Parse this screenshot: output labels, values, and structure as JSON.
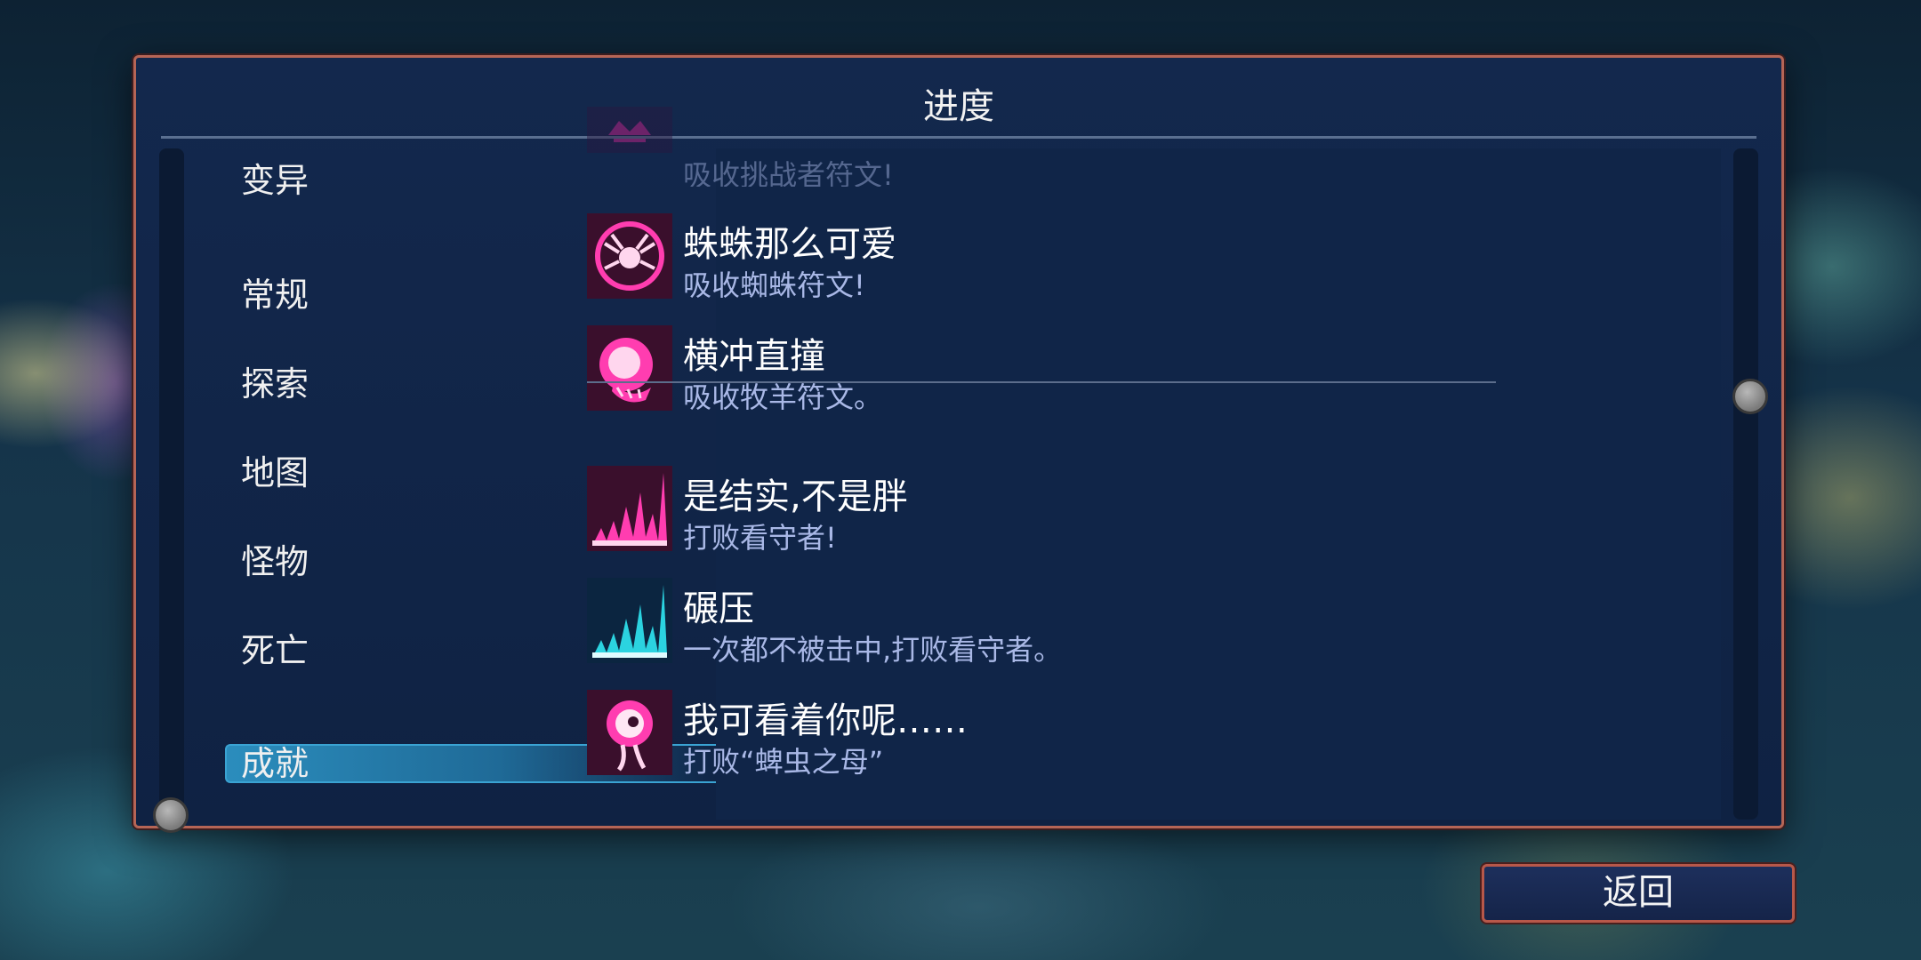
{
  "panel": {
    "title": "进度"
  },
  "categories": [
    {
      "label": "变异",
      "selected": false
    },
    {
      "label": "常规",
      "selected": false
    },
    {
      "label": "探索",
      "selected": false
    },
    {
      "label": "地图",
      "selected": false
    },
    {
      "label": "怪物",
      "selected": false
    },
    {
      "label": "死亡",
      "selected": false
    },
    {
      "label": "成就",
      "selected": true
    }
  ],
  "achievements": [
    {
      "name": "",
      "desc": "吸收挑战者符文!",
      "icon": "challenger-rune-icon",
      "color": "#d81f8c"
    },
    {
      "name": "蛛蛛那么可爱",
      "desc": "吸收蜘蛛符文!",
      "icon": "spider-rune-icon",
      "color": "#d81f8c"
    },
    {
      "name": "横冲直撞",
      "desc": "吸收牧羊符文。",
      "icon": "ram-rune-icon",
      "color": "#d81f8c"
    },
    {
      "name": "是结实,不是胖",
      "desc": "打败看守者!",
      "icon": "concierge-pink-icon",
      "color": "#d81f8c"
    },
    {
      "name": "碾压",
      "desc": "一次都不被击中,打败看守者。",
      "icon": "concierge-blue-icon",
      "color": "#2bd3e0"
    },
    {
      "name": "我可看着你呢……",
      "desc": "打败“蜱虫之母”",
      "icon": "eye-creature-icon",
      "color": "#d81f8c"
    }
  ],
  "footer": {
    "back_label": "返回"
  }
}
